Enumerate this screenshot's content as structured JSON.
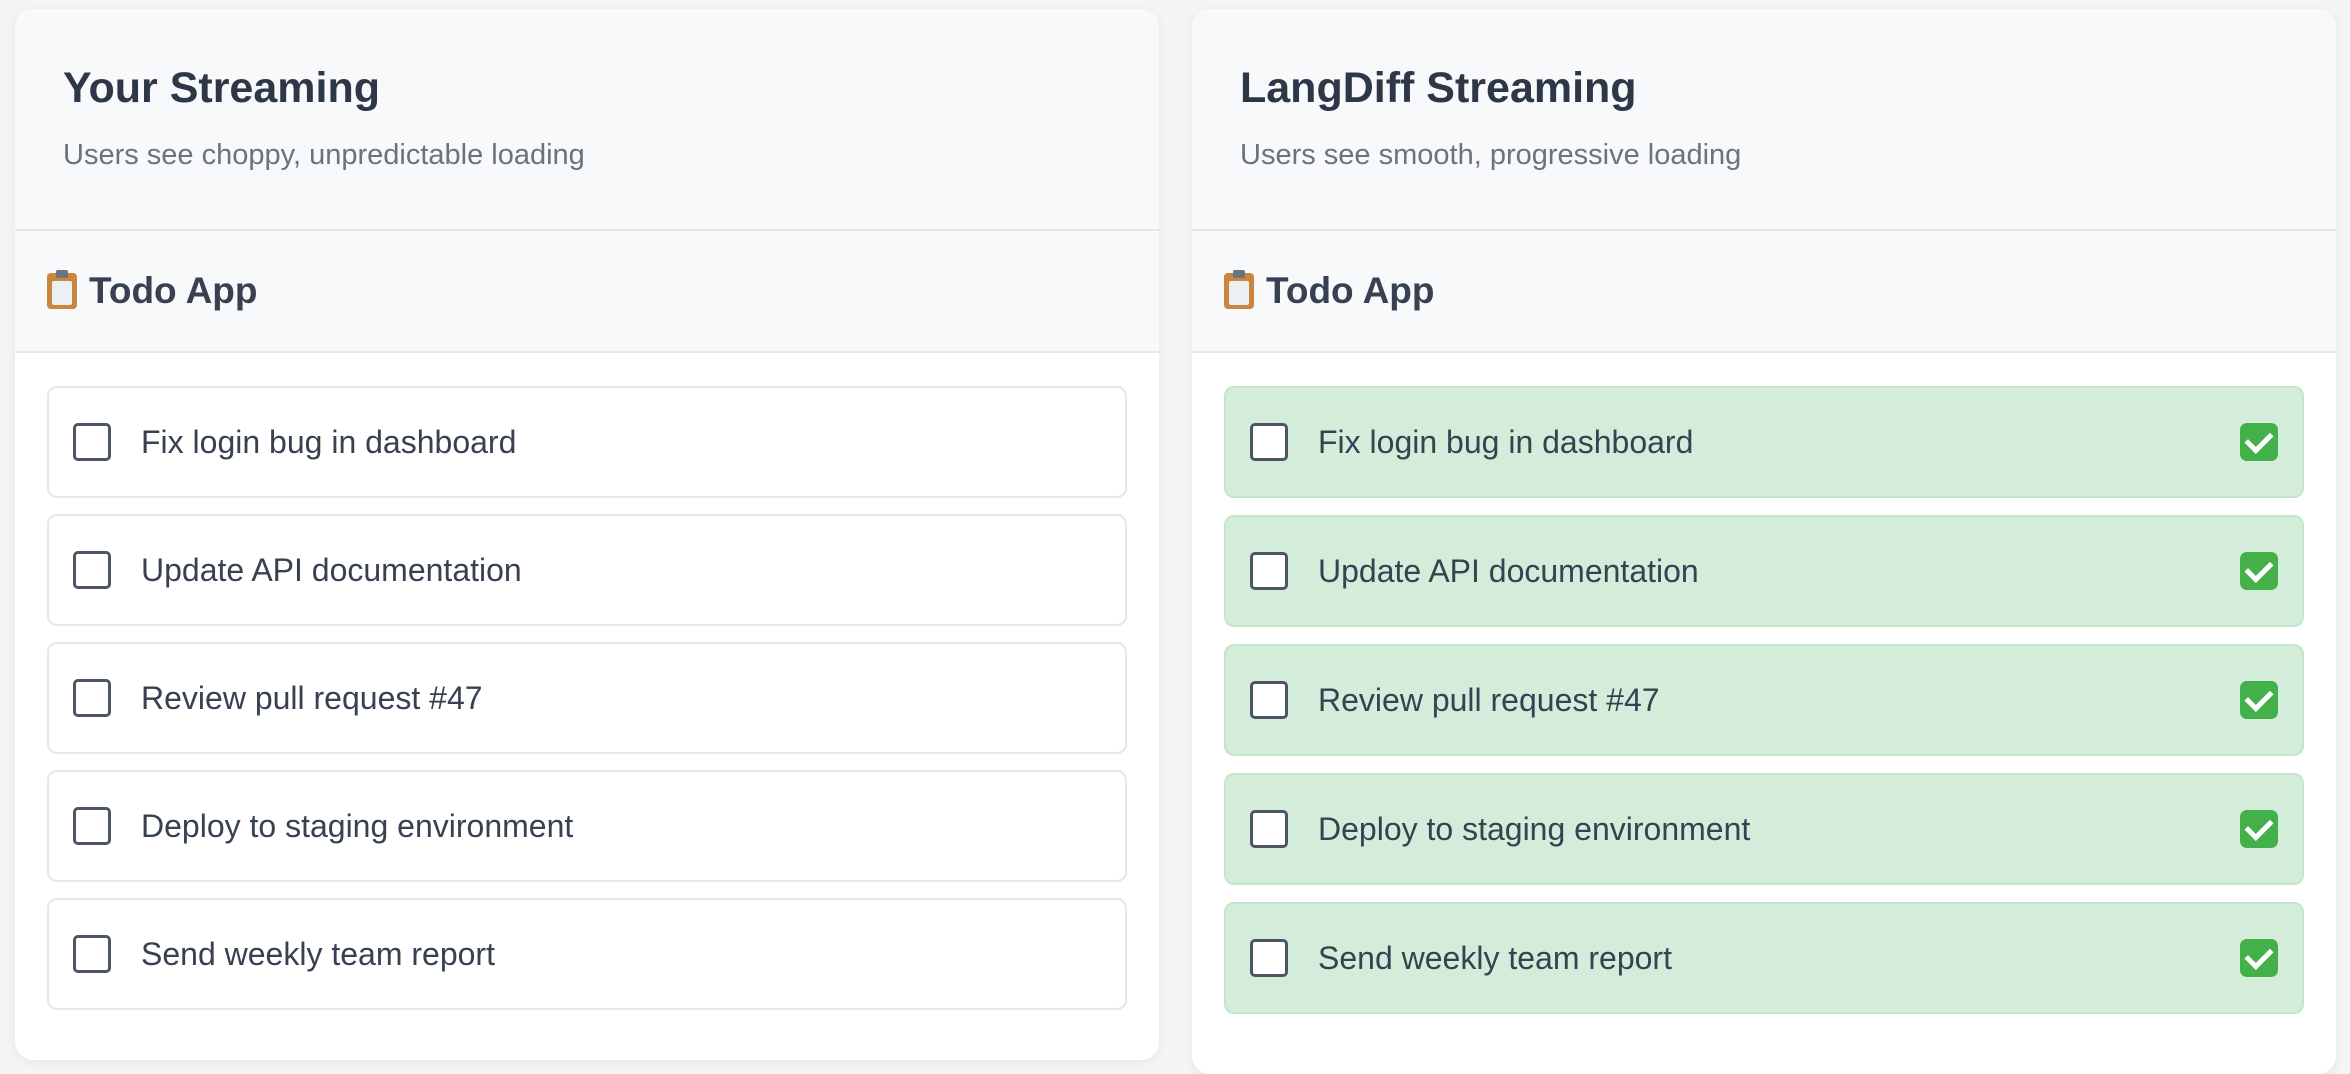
{
  "left_panel": {
    "title": "Your Streaming",
    "subtitle": "Users see choppy, unpredictable loading",
    "app": {
      "icon": "clipboard-icon",
      "title": "Todo App",
      "items": [
        {
          "text": "Fix login bug in dashboard",
          "checked": false
        },
        {
          "text": "Update API documentation",
          "checked": false
        },
        {
          "text": "Review pull request #47",
          "checked": false
        },
        {
          "text": "Deploy to staging environment",
          "checked": false
        },
        {
          "text": "Send weekly team report",
          "checked": false
        }
      ]
    }
  },
  "right_panel": {
    "title": "LangDiff Streaming",
    "subtitle": "Users see smooth, progressive loading",
    "app": {
      "icon": "clipboard-icon",
      "title": "Todo App",
      "items": [
        {
          "text": "Fix login bug in dashboard",
          "checked": false,
          "loaded_icon": "check-mark-icon"
        },
        {
          "text": "Update API documentation",
          "checked": false,
          "loaded_icon": "check-mark-icon"
        },
        {
          "text": "Review pull request #47",
          "checked": false,
          "loaded_icon": "check-mark-icon"
        },
        {
          "text": "Deploy to staging environment",
          "checked": false,
          "loaded_icon": "check-mark-icon"
        },
        {
          "text": "Send weekly team report",
          "checked": false,
          "loaded_icon": "check-mark-icon"
        }
      ]
    }
  },
  "colors": {
    "loaded_item_bg": "#d4edda",
    "loaded_item_border": "#c3e6cb",
    "check_icon_green": "#43b049",
    "title_text": "#2d3748",
    "subtitle_text": "#6b7280"
  }
}
